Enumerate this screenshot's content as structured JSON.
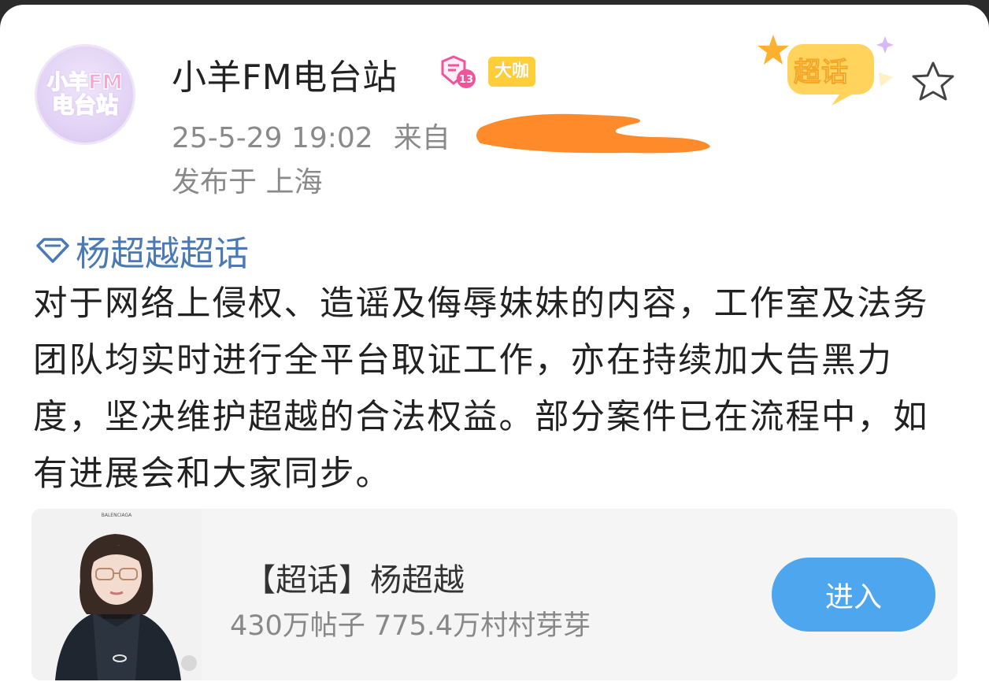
{
  "post": {
    "author": {
      "name": "小羊FM电台站",
      "avatar_text_line1": "小羊FM",
      "avatar_text_line2": "电台站",
      "level": "13",
      "badge": "大咖"
    },
    "time": "25-5-29 19:02",
    "source_prefix": "来自",
    "location": "发布于 上海",
    "sticker_label": "超话",
    "topic_link": "杨超越超话",
    "body": "对于网络上侵权、造谣及侮辱妹妹的内容，工作室及法务团队均实时进行全平台取证工作，亦在持续加大告黑力度，坚决维护超越的合法权益。部分案件已在流程中，如有进展会和大家同步。"
  },
  "topic_card": {
    "title": "【超话】杨超越",
    "stats": "430万帖子 775.4万村村芽芽",
    "enter_label": "进入",
    "thumb_brand": "BALENCIAGA"
  },
  "colors": {
    "link": "#4b79b4",
    "enter_button": "#4da6ee",
    "badge_yellow": "#ffcf3a",
    "redaction": "#ff8a2a"
  }
}
